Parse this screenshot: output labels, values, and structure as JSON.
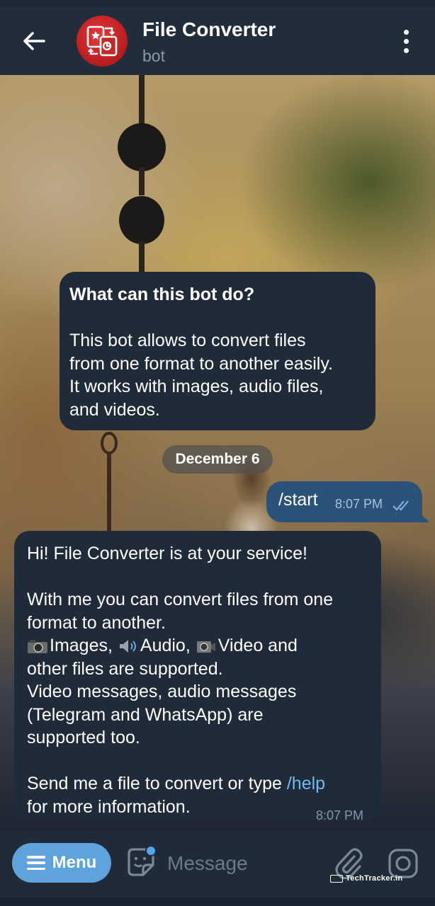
{
  "header": {
    "title": "File Converter",
    "subtitle": "bot",
    "icons": [
      "back-arrow-icon",
      "bot-avatar",
      "more-vertical-icon"
    ]
  },
  "intro_card": {
    "title": "What can this bot do?",
    "body": "This bot allows to convert files\nfrom one format to another easily.\nIt works with images, audio files,\nand videos."
  },
  "date_separator": "December 6",
  "outgoing": {
    "text": "/start",
    "time": "8:07 PM",
    "status": "read"
  },
  "reply": {
    "line1": "Hi! File Converter is at your service!",
    "line2": "With me you can convert files from one",
    "line3": "format to another.",
    "images": "Images,",
    "audio": "Audio,",
    "video": "Video and",
    "line5": "other files are supported.",
    "line6": "Video messages, audio messages",
    "line7": "(Telegram and WhatsApp) are",
    "line8": "supported too.",
    "line9_pre": "Send me a file to convert or type ",
    "help_cmd": "/help",
    "line10": "for more information.",
    "time": "8:07 PM"
  },
  "input_bar": {
    "menu_label": "Menu",
    "placeholder": "Message",
    "watermark": "TechTracker.in"
  },
  "colors": {
    "header_bg": "#212d3b",
    "incoming_bubble": "#1f2b38",
    "outgoing_bubble": "#2b5278",
    "menu_button": "#5fa3de",
    "link": "#71baf2"
  }
}
